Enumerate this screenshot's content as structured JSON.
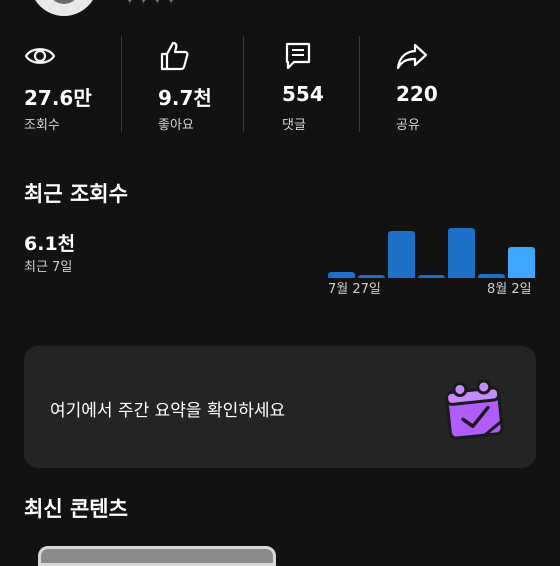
{
  "header": {
    "stars": "✦✦✦✦"
  },
  "stats": [
    {
      "icon": "eye-icon",
      "value": "27.6만",
      "label": "조회수"
    },
    {
      "icon": "thumbs-up-icon",
      "value": "9.7천",
      "label": "좋아요"
    },
    {
      "icon": "comment-icon",
      "value": "554",
      "label": "댓글"
    },
    {
      "icon": "share-icon",
      "value": "220",
      "label": "공유"
    }
  ],
  "recent": {
    "title": "최근 조회수",
    "value": "6.1천",
    "subtitle": "최근 7일"
  },
  "chart_data": {
    "type": "bar",
    "categories": [
      "7월 27일",
      "",
      "",
      "",
      "",
      "",
      "8월 2일"
    ],
    "tick_labels": [
      "7월 27일",
      "8월 2일"
    ],
    "values": [
      0.12,
      0.05,
      0.93,
      0.05,
      1.0,
      0.07,
      0.62
    ],
    "value_scale": "relative",
    "highlight_index": 6,
    "colors": {
      "bar": "#1e6fc8",
      "highlight": "#3ea6ff"
    }
  },
  "summary_card": {
    "text": "여기에서 주간 요약을 확인하세요",
    "icon": "calendar-check-icon",
    "accent": "#b05cff"
  },
  "latest": {
    "title": "최신 콘텐츠"
  }
}
